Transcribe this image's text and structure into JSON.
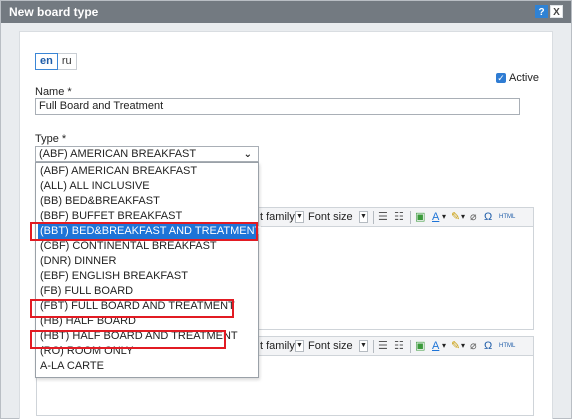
{
  "window": {
    "title": "New board type",
    "help_label": "?",
    "close_label": "X"
  },
  "languages": [
    {
      "label": "en",
      "active": true
    },
    {
      "label": "ru",
      "active": false
    }
  ],
  "active_toggle": {
    "label": "Active",
    "checked": true,
    "check_glyph": "✓"
  },
  "name_field": {
    "label": "Name *",
    "value": "Full Board and Treatment"
  },
  "type_field": {
    "label": "Type *",
    "value": "(ABF) AMERICAN BREAKFAST",
    "chevron": "⌄",
    "options": [
      "(ABF) AMERICAN BREAKFAST",
      "(ALL) ALL INCLUSIVE",
      "(BB) BED&BREAKFAST",
      "(BBF) BUFFET BREAKFAST",
      "(BBT) BED&BREAKFAST AND TREATMENT",
      "(CBF) CONTINENTAL BREAKFAST",
      "(DNR) DINNER",
      "(EBF) ENGLISH BREAKFAST",
      "(FB) FULL BOARD",
      "(FBT) FULL BOARD AND TREATMENT",
      "(HB) HALF BOARD",
      "(HBT) HALF BOARD AND TREATMENT",
      "(RO) ROOM ONLY",
      "A-LA CARTE"
    ],
    "selected_option": "(BBT) BED&BREAKFAST AND TREATMENT",
    "highlighted_options": [
      "(BBT) BED&BREAKFAST AND TREATMENT",
      "(FBT) FULL BOARD AND TREATMENT",
      "(HBT) HALF BOARD AND TREATMENT"
    ]
  },
  "editor_toolbar": {
    "font_family_label": "t family",
    "font_size_label": "Font size",
    "html_label": "HTML",
    "icons": [
      "dropdown-arrow-icon",
      "bulleted-list-icon",
      "numbered-list-icon",
      "insert-image-icon",
      "text-color-icon",
      "highlight-color-icon",
      "clear-format-icon",
      "omega-symbol-icon"
    ]
  },
  "colors": {
    "titlebar": "#737a81",
    "accent": "#1e74d7",
    "highlight_border": "#e21b23"
  }
}
